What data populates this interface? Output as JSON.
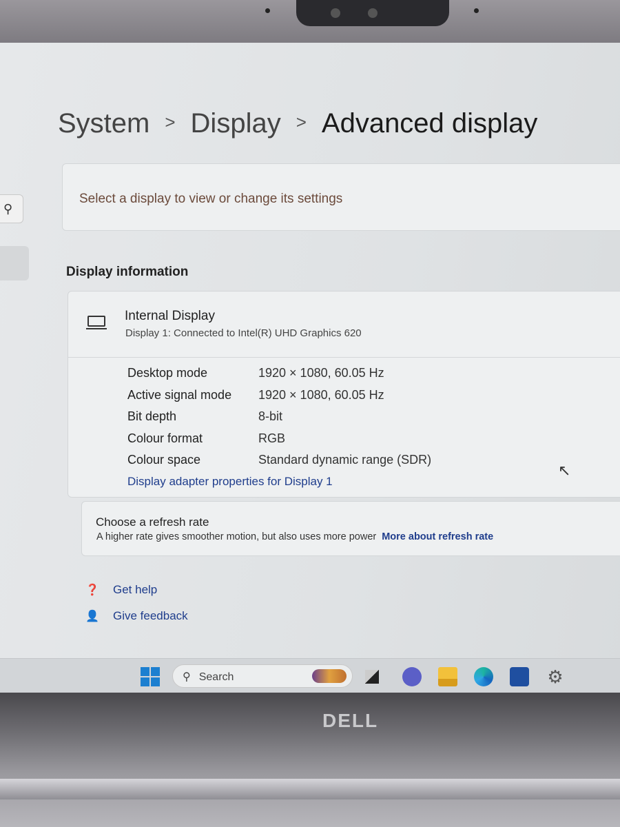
{
  "breadcrumb": {
    "items": [
      "System",
      "Display"
    ],
    "current": "Advanced display"
  },
  "select_display": {
    "text": "Select a display to view or change its settings"
  },
  "display_information": {
    "heading": "Display information",
    "display_name": "Internal Display",
    "display_subtitle": "Display 1: Connected to Intel(R) UHD Graphics 620",
    "rows": [
      {
        "label": "Desktop mode",
        "value": "1920 × 1080, 60.05 Hz"
      },
      {
        "label": "Active signal mode",
        "value": "1920 × 1080, 60.05 Hz"
      },
      {
        "label": "Bit depth",
        "value": "8-bit"
      },
      {
        "label": "Colour format",
        "value": "RGB"
      },
      {
        "label": "Colour space",
        "value": "Standard dynamic range (SDR)"
      }
    ],
    "adapter_link": "Display adapter properties for Display 1"
  },
  "refresh": {
    "title": "Choose a refresh rate",
    "description": "A higher rate gives smoother motion, but also uses more power",
    "link": "More about refresh rate"
  },
  "help_links": {
    "get_help": "Get help",
    "give_feedback": "Give feedback"
  },
  "taskbar": {
    "search_placeholder": "Search",
    "icons": [
      "windows-start",
      "search",
      "widgets",
      "task-view",
      "teams-chat",
      "file-explorer",
      "edge",
      "microsoft-store",
      "settings"
    ]
  },
  "colors": {
    "link": "#1f3d8c",
    "accent": "#1c7fd0"
  },
  "brand": "DELL"
}
